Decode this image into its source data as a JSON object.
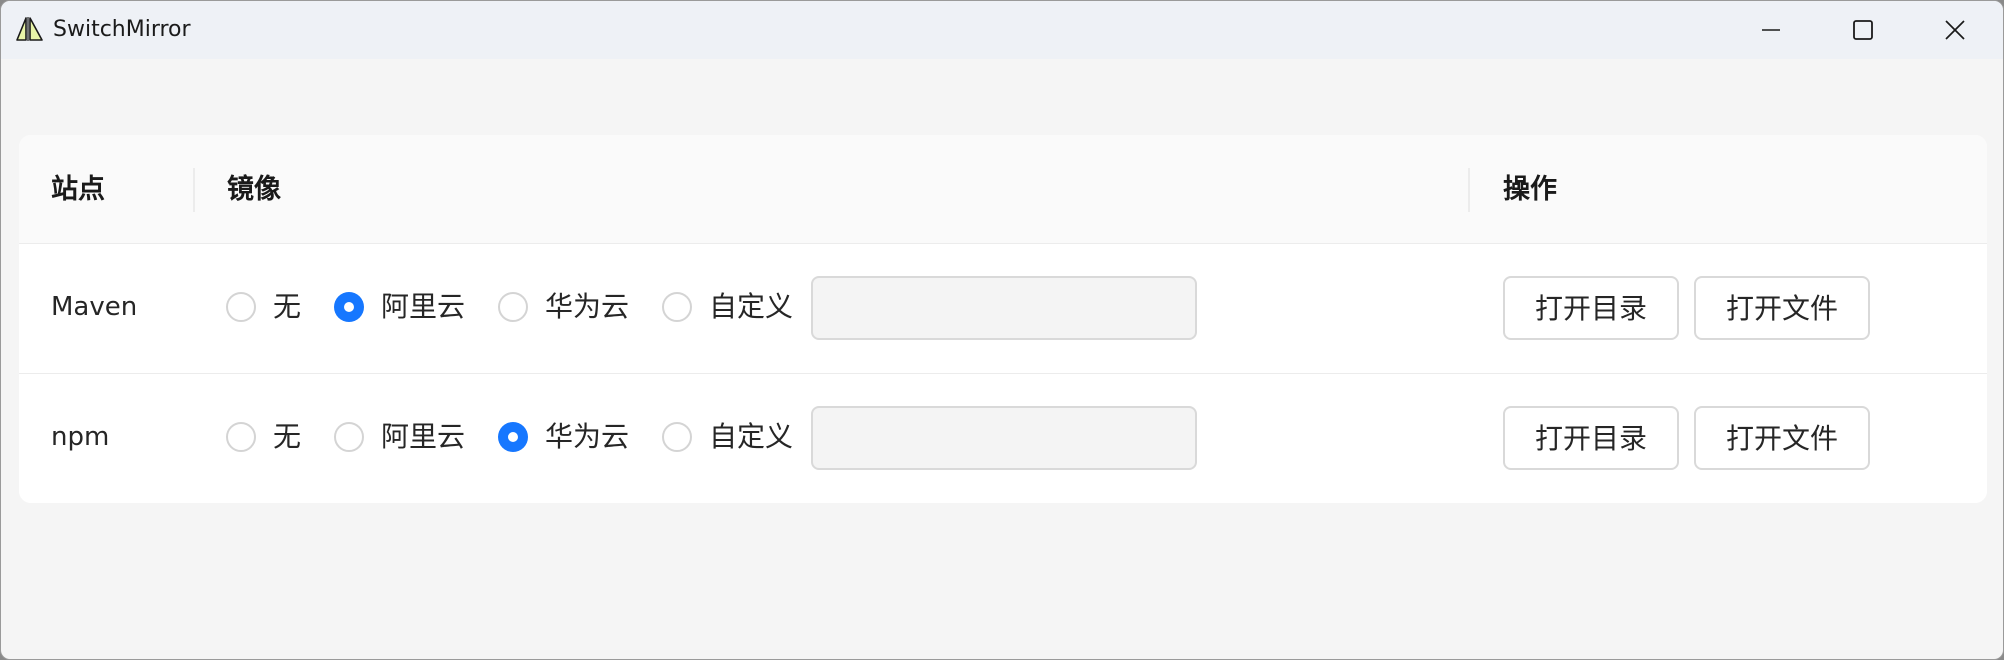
{
  "window": {
    "title": "SwitchMirror"
  },
  "table": {
    "headers": {
      "site": "站点",
      "mirror": "镜像",
      "action": "操作"
    },
    "rows": [
      {
        "site": "Maven",
        "options": [
          "无",
          "阿里云",
          "华为云",
          "自定义"
        ],
        "selected": "阿里云",
        "custom_value": "",
        "open_dir_label": "打开目录",
        "open_file_label": "打开文件"
      },
      {
        "site": "npm",
        "options": [
          "无",
          "阿里云",
          "华为云",
          "自定义"
        ],
        "selected": "华为云",
        "custom_value": "",
        "open_dir_label": "打开目录",
        "open_file_label": "打开文件"
      }
    ]
  },
  "colors": {
    "accent": "#1677ff"
  }
}
